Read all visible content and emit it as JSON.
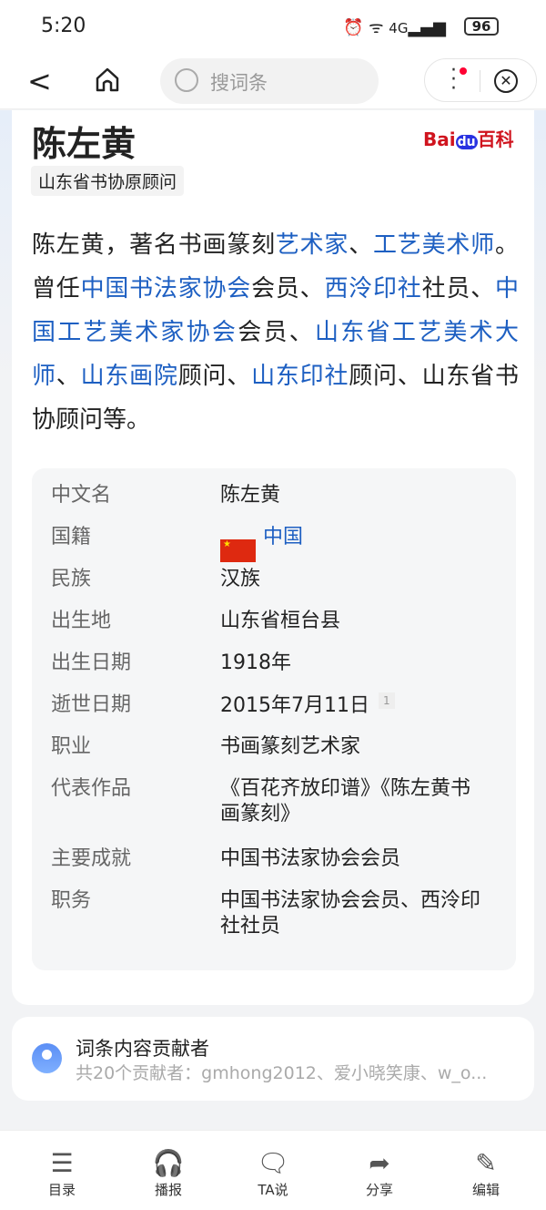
{
  "status": {
    "time": "5:20",
    "network": "4G",
    "battery": "96"
  },
  "nav": {
    "search_placeholder": "搜词条"
  },
  "article": {
    "title": "陈左黄",
    "logo": "Bai du 百科",
    "tag": "山东省书协原顾问",
    "summary": [
      {
        "t": "陈左黄，著名书画篆刻",
        "link": false
      },
      {
        "t": "艺术家",
        "link": true
      },
      {
        "t": "、",
        "link": false
      },
      {
        "t": "工艺美术师",
        "link": true
      },
      {
        "t": "。曾任",
        "link": false
      },
      {
        "t": "中国书法家协会",
        "link": true
      },
      {
        "t": "会员、",
        "link": false
      },
      {
        "t": "西泠印社",
        "link": true
      },
      {
        "t": "社员、",
        "link": false
      },
      {
        "t": "中国工艺美术家协会",
        "link": true
      },
      {
        "t": "会员、",
        "link": false
      },
      {
        "t": "山东省工艺美术大师",
        "link": true
      },
      {
        "t": "、",
        "link": false
      },
      {
        "t": "山东画院",
        "link": true
      },
      {
        "t": "顾问、",
        "link": false
      },
      {
        "t": "山东印社",
        "link": true
      },
      {
        "t": "顾问、山东省书协顾问等。",
        "link": false
      }
    ]
  },
  "infobox": [
    {
      "k": "中文名",
      "v": "陈左黄"
    },
    {
      "k": "国籍",
      "v": "中国",
      "flag": true
    },
    {
      "k": "民族",
      "v": "汉族"
    },
    {
      "k": "出生地",
      "v": "山东省桓台县"
    },
    {
      "k": "出生日期",
      "v": "1918年"
    },
    {
      "k": "逝世日期",
      "v": "2015年7月11日",
      "ref": "1"
    },
    {
      "k": "职业",
      "v": "书画篆刻艺术家"
    },
    {
      "k": "代表作品",
      "v": "《百花齐放印谱》《陈左黄书画篆刻》"
    },
    {
      "k": "主要成就",
      "v": "中国书法家协会会员"
    },
    {
      "k": "职务",
      "v": "中国书法家协会会员、西泠印社社员"
    }
  ],
  "contributors": {
    "title": "词条内容贡献者",
    "summary": "共20个贡献者：gmhong2012、爱小晓笑康、w_o..."
  },
  "toolbar": [
    {
      "label": "目录",
      "icon": "list-icon"
    },
    {
      "label": "播报",
      "icon": "headphones-icon"
    },
    {
      "label": "TA说",
      "icon": "comment-icon"
    },
    {
      "label": "分享",
      "icon": "share-icon"
    },
    {
      "label": "编辑",
      "icon": "edit-icon"
    }
  ]
}
